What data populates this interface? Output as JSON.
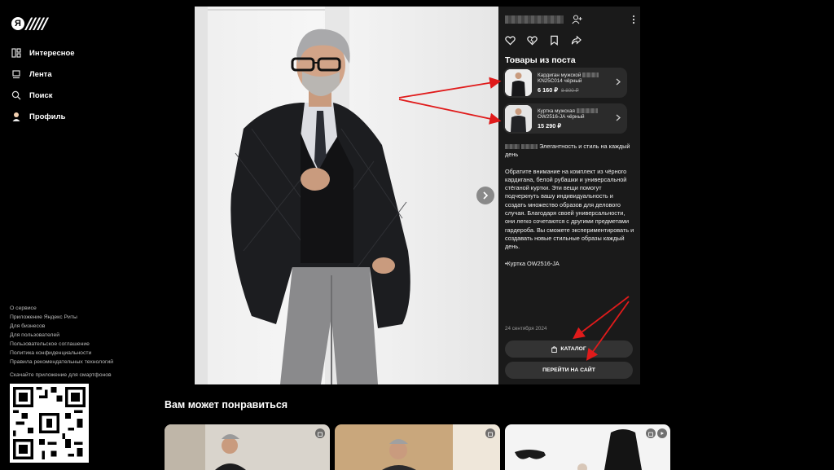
{
  "sidebar": {
    "nav": [
      {
        "label": "Интересное",
        "icon": "grid-icon"
      },
      {
        "label": "Лента",
        "icon": "feed-icon"
      },
      {
        "label": "Поиск",
        "icon": "search-icon"
      },
      {
        "label": "Профиль",
        "icon": "profile-icon"
      }
    ],
    "footer_links": [
      "О сервисе",
      "Приложение Яндекс Риты",
      "Для бизнесов",
      "Для пользователей",
      "Пользовательское соглашение",
      "Политика конфиденциальности",
      "Правила рекомендательных технологий"
    ],
    "app_caption": "Скачайте приложение для смартфонов"
  },
  "logo": {
    "ya": "Я"
  },
  "post": {
    "products_title": "Товары из поста",
    "products": [
      {
        "name": "Кардиган мужской",
        "code": "KN25C014 чёрный",
        "price": "6 160 ₽",
        "old_price": "8 800 ₽"
      },
      {
        "name": "Куртка мужская",
        "code": "OW2516-JA чёрный",
        "price": "15 290 ₽",
        "old_price": ""
      }
    ],
    "headline_tail": "Элегантность и стиль на каждый день",
    "body": "Обратите внимание на комплект из чёрного кардигана, белой рубашки и универсальной стёганой куртки. Эти вещи помогут подчеркнуть вашу индивидуальность и создать множество образов для делового случая. Благодаря своей универсальности, они легко сочетаются с другими предметами гардероба. Вы сможете экспериментировать и создавать новые стильные образы каждый день.",
    "tag_line": "•Куртка OW2516-JA",
    "date": "24 сентября 2024",
    "catalog_button": "КАТАЛОГ",
    "site_button": "ПЕРЕЙТИ НА САЙТ"
  },
  "recommendations": {
    "title": "Вам может понравиться"
  },
  "colors": {
    "panel": "#1a1a1a",
    "annotation_arrow": "#e01b1b",
    "button": "#333333"
  }
}
